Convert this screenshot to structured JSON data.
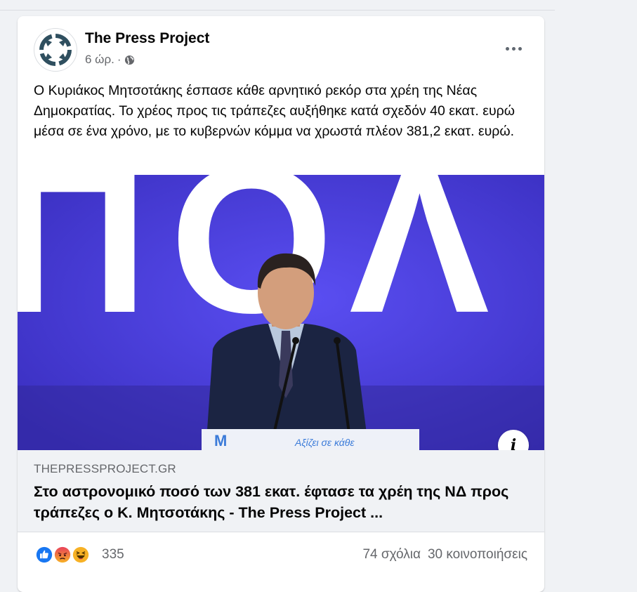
{
  "post": {
    "page_name": "The Press Project",
    "time": "6 ώρ.",
    "separator": "·",
    "audience_icon": "globe-icon",
    "text": "Ο Κυριάκος Μητσοτάκης έσπασε κάθε αρνητικό ρεκόρ στα χρέη της Νέας Δημοκρατίας. Το χρέος προς τις τράπεζες αυξήθηκε κατά σχεδόν 40 εκατ. ευρώ μέσα σε ένα χρόνο, με το κυβερνών κόμμα να χρωστά πλέον 381,2 εκατ. ευρώ."
  },
  "link": {
    "backdrop_text": "ΠΟΛ",
    "podium_text": "Αξίζει σε κάθε",
    "info_glyph": "i",
    "domain": "THEPRESSPROJECT.GR",
    "title": "Στο αστρονομικό ποσό των 381 εκατ. έφτασε τα χρέη της ΝΔ προς τράπεζες ο Κ. Μητσοτάκης - The Press Project ..."
  },
  "engagement": {
    "reaction_icons": [
      "like-icon",
      "angry-icon",
      "haha-icon"
    ],
    "reaction_count": "335",
    "comments": "74 σχόλια",
    "shares": "30 κοινοποιήσεις"
  },
  "colors": {
    "like": "#1877f2",
    "angry": "#e9710f",
    "haha": "#f7b125",
    "backdrop": "#4a3fd9"
  }
}
